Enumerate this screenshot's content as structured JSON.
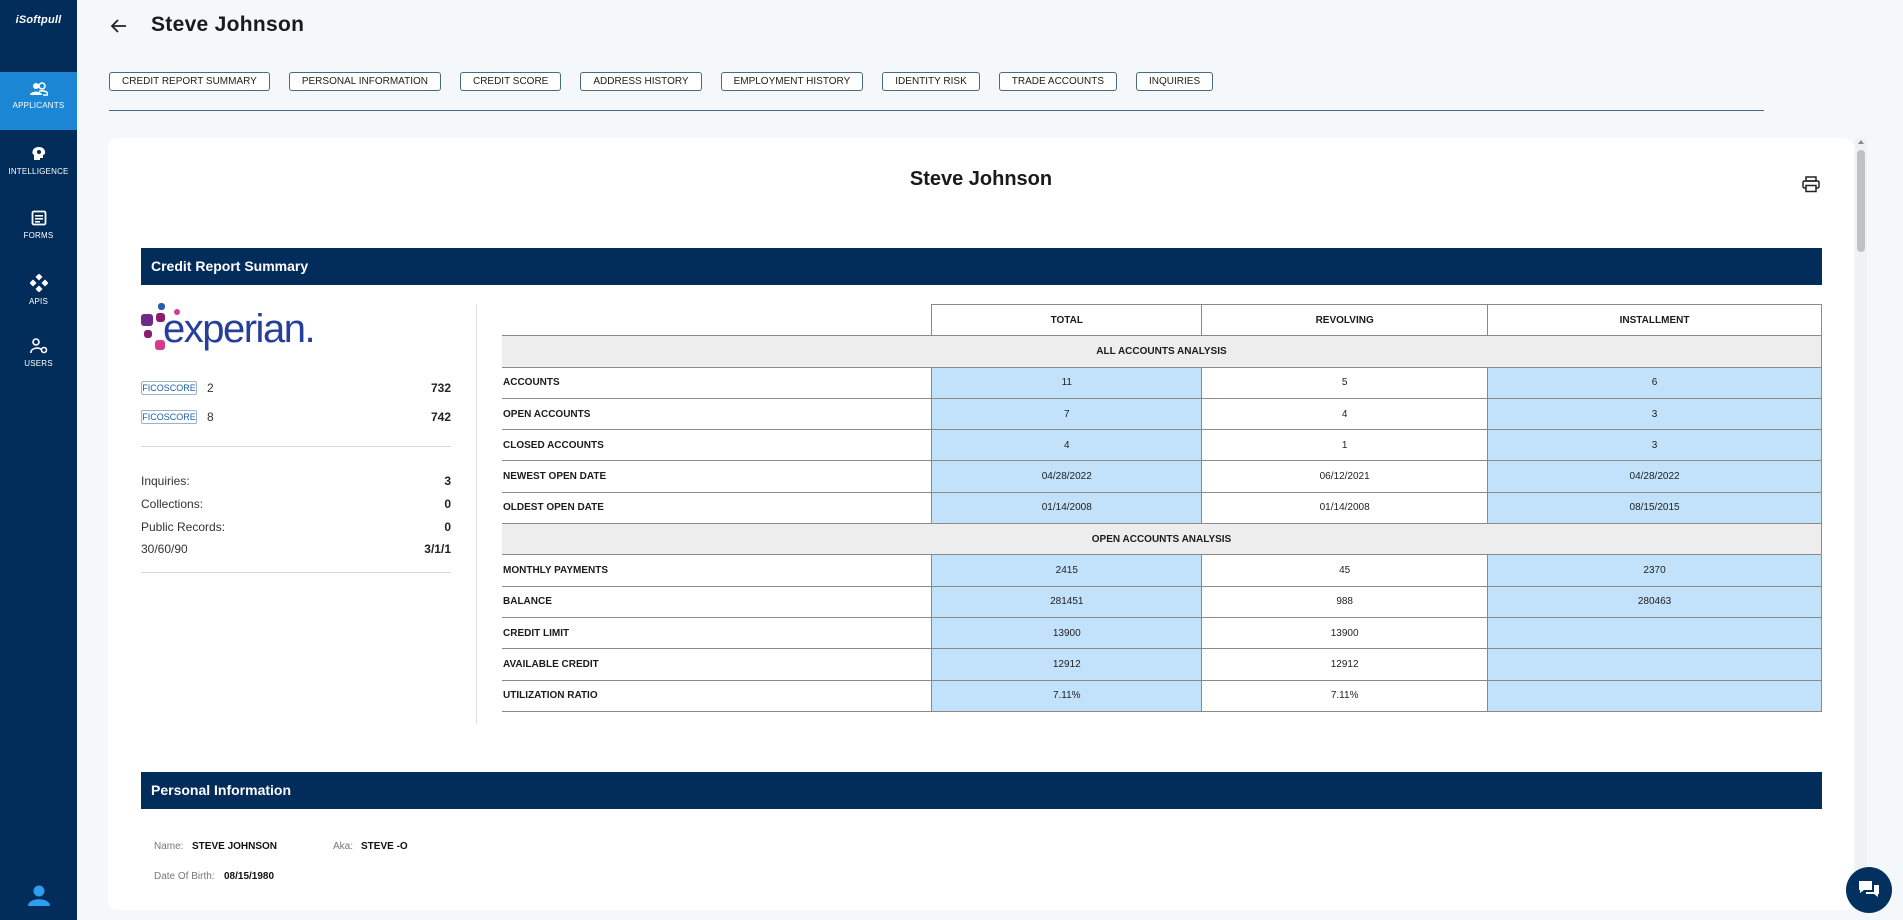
{
  "app": {
    "logo_text": "iSoftpull"
  },
  "sidebar": {
    "items": [
      {
        "label": "APPLICANTS",
        "icon": "people-icon",
        "active": true
      },
      {
        "label": "INTELLIGENCE",
        "icon": "brain-icon",
        "active": false
      },
      {
        "label": "FORMS",
        "icon": "form-icon",
        "active": false
      },
      {
        "label": "APIS",
        "icon": "api-icon",
        "active": false
      },
      {
        "label": "USERS",
        "icon": "user-gear-icon",
        "active": false
      }
    ]
  },
  "header": {
    "title": "Steve Johnson"
  },
  "tabs": [
    {
      "label": "CREDIT REPORT SUMMARY"
    },
    {
      "label": "PERSONAL INFORMATION"
    },
    {
      "label": "CREDIT SCORE"
    },
    {
      "label": "ADDRESS HISTORY"
    },
    {
      "label": "EMPLOYMENT HISTORY"
    },
    {
      "label": "IDENTITY RISK"
    },
    {
      "label": "TRADE ACCOUNTS"
    },
    {
      "label": "INQUIRIES"
    }
  ],
  "report": {
    "name": "Steve Johnson",
    "summary_header": "Credit Report Summary",
    "bureau_logo_text": "experian.",
    "fico": [
      {
        "badge": "FICOSCORE",
        "model": "2",
        "score": "732"
      },
      {
        "badge": "FICOSCORE",
        "model": "8",
        "score": "742"
      }
    ],
    "stats": [
      {
        "label": "Inquiries:",
        "value": "3"
      },
      {
        "label": "Collections:",
        "value": "0"
      },
      {
        "label": "Public Records:",
        "value": "0"
      },
      {
        "label": "30/60/90",
        "value": "3/1/1"
      }
    ],
    "table": {
      "columns": [
        "TOTAL",
        "REVOLVING",
        "INSTALLMENT"
      ],
      "groups": [
        {
          "title": "ALL ACCOUNTS ANALYSIS",
          "rows": [
            {
              "label": "ACCOUNTS",
              "values": [
                "11",
                "5",
                "6"
              ]
            },
            {
              "label": "OPEN ACCOUNTS",
              "values": [
                "7",
                "4",
                "3"
              ]
            },
            {
              "label": "CLOSED ACCOUNTS",
              "values": [
                "4",
                "1",
                "3"
              ]
            },
            {
              "label": "NEWEST OPEN DATE",
              "values": [
                "04/28/2022",
                "06/12/2021",
                "04/28/2022"
              ]
            },
            {
              "label": "OLDEST OPEN DATE",
              "values": [
                "01/14/2008",
                "01/14/2008",
                "08/15/2015"
              ]
            }
          ]
        },
        {
          "title": "OPEN ACCOUNTS ANALYSIS",
          "rows": [
            {
              "label": "MONTHLY PAYMENTS",
              "values": [
                "2415",
                "45",
                "2370"
              ]
            },
            {
              "label": "BALANCE",
              "values": [
                "281451",
                "988",
                "280463"
              ]
            },
            {
              "label": "CREDIT LIMIT",
              "values": [
                "13900",
                "13900",
                ""
              ]
            },
            {
              "label": "AVAILABLE CREDIT",
              "values": [
                "12912",
                "12912",
                ""
              ]
            },
            {
              "label": "UTILIZATION RATIO",
              "values": [
                "7.11%",
                "7.11%",
                ""
              ]
            }
          ]
        }
      ]
    },
    "personal_header": "Personal Information",
    "personal": {
      "name_label": "Name:",
      "name_value": "STEVE JOHNSON",
      "aka_label": "Aka:",
      "aka_value": "STEVE -O",
      "dob_label": "Date Of Birth:",
      "dob_value": "08/15/1980"
    }
  },
  "colors": {
    "sidebar": "#022c5a",
    "active_nav": "#1a86d4",
    "cell_blue": "#c2e1fa",
    "section_header": "#022c5a"
  }
}
